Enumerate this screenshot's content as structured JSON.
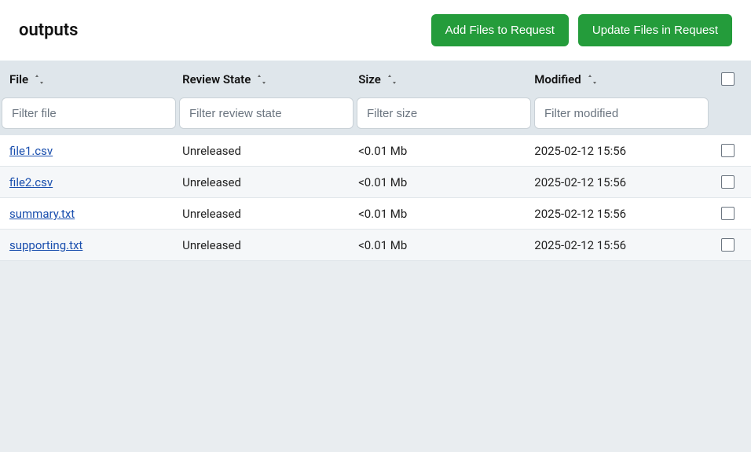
{
  "header": {
    "title": "outputs",
    "add_files_label": "Add Files to Request",
    "update_files_label": "Update Files in Request"
  },
  "columns": {
    "file": "File",
    "review_state": "Review State",
    "size": "Size",
    "modified": "Modified"
  },
  "filters": {
    "file_placeholder": "Filter file",
    "review_placeholder": "Filter review state",
    "size_placeholder": "Filter size",
    "modified_placeholder": "Filter modified"
  },
  "rows": [
    {
      "file": "file1.csv",
      "review_state": "Unreleased",
      "size": "<0.01 Mb",
      "modified": "2025-02-12 15:56"
    },
    {
      "file": "file2.csv",
      "review_state": "Unreleased",
      "size": "<0.01 Mb",
      "modified": "2025-02-12 15:56"
    },
    {
      "file": "summary.txt",
      "review_state": "Unreleased",
      "size": "<0.01 Mb",
      "modified": "2025-02-12 15:56"
    },
    {
      "file": "supporting.txt",
      "review_state": "Unreleased",
      "size": "<0.01 Mb",
      "modified": "2025-02-12 15:56"
    }
  ]
}
